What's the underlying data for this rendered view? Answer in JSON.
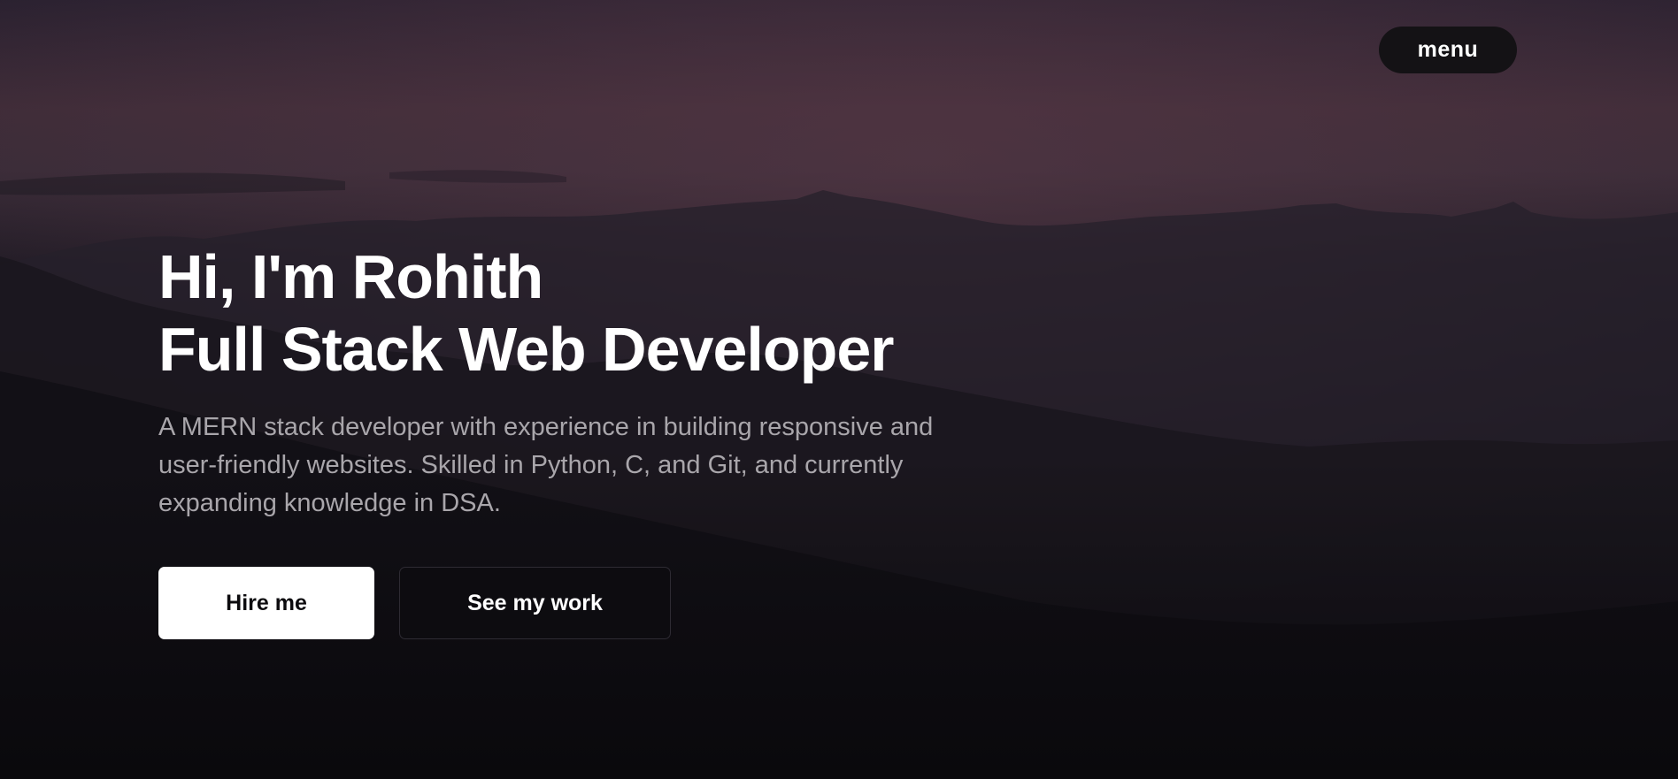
{
  "nav": {
    "menu_label": "menu"
  },
  "hero": {
    "greeting": "Hi, I'm Rohith",
    "role": "Full Stack Web Developer",
    "description": "A MERN stack developer with experience in building responsive and user-friendly websites. Skilled in Python, C, and Git, and currently expanding knowledge in DSA.",
    "primary_cta": "Hire me",
    "secondary_cta": "See my work"
  },
  "colors": {
    "background": "#0b0a0d",
    "sky_accent": "#4a3240",
    "text_primary": "#ffffff",
    "text_muted": "#a9a6ab",
    "button_primary_bg": "#ffffff",
    "button_secondary_bg": "#0d0c10"
  }
}
